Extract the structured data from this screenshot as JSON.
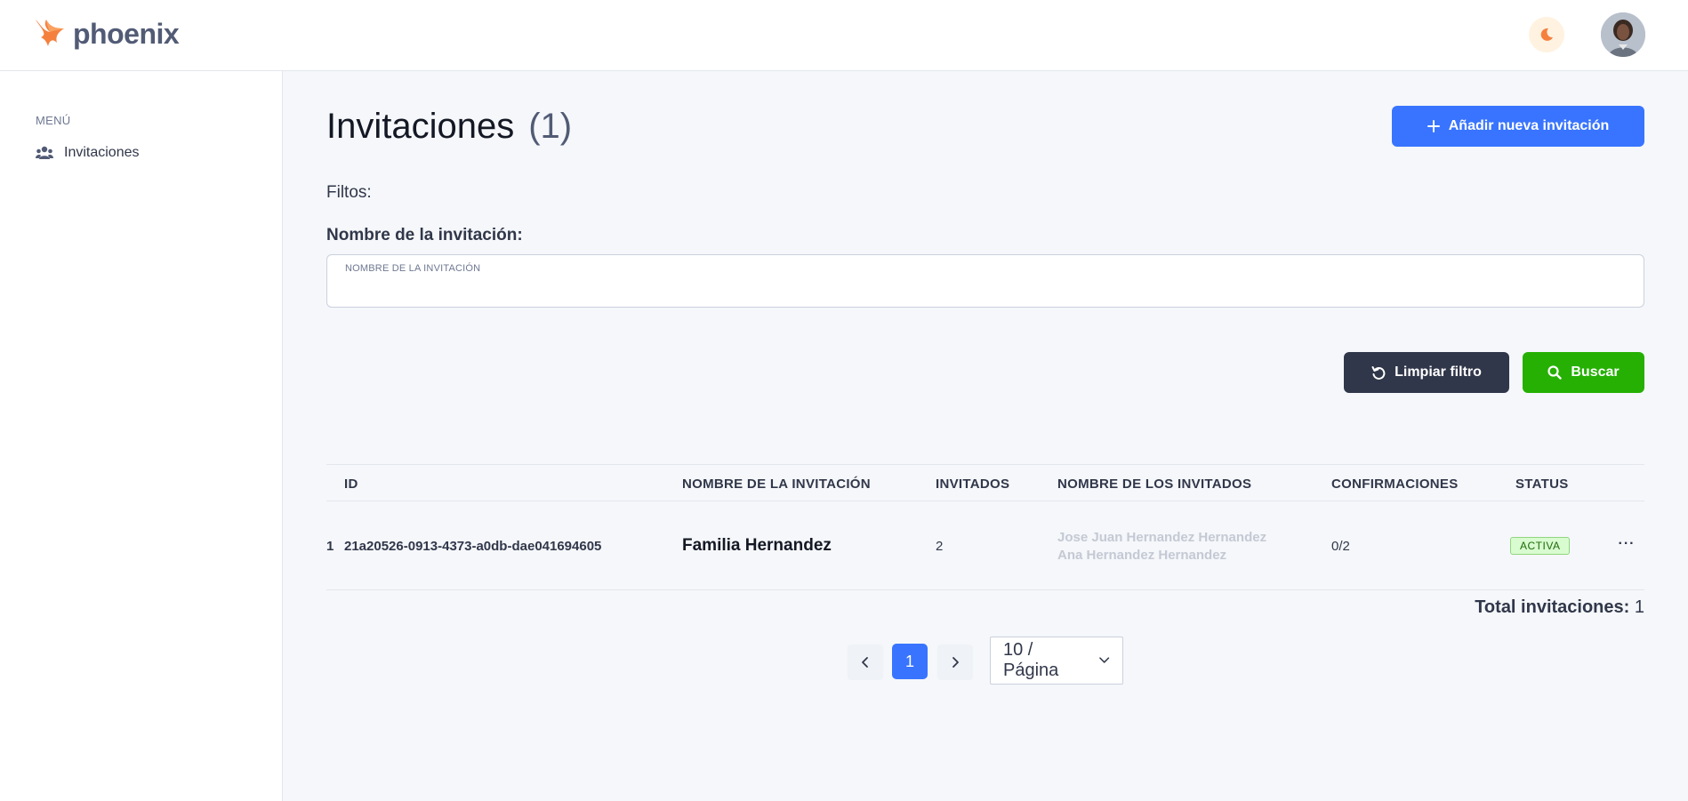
{
  "brand": {
    "name": "phoenix"
  },
  "sidebar": {
    "menu_label": "MENÚ",
    "items": [
      {
        "label": "Invitaciones",
        "icon": "users-icon"
      }
    ]
  },
  "header": {
    "title": "Invitaciones",
    "count": "(1)",
    "add_button": "Añadir nueva invitación"
  },
  "filters": {
    "label": "Filtos:",
    "name_field_label": "Nombre de la invitación:",
    "name_field_placeholder": "NOMBRE DE LA INVITACIÓN",
    "name_field_value": "",
    "clear_button": "Limpiar filtro",
    "search_button": "Buscar"
  },
  "table": {
    "columns": [
      "ID",
      "NOMBRE DE LA INVITACIÓN",
      "INVITADOS",
      "NOMBRE DE LOS INVITADOS",
      "CONFIRMACIONES",
      "STATUS"
    ],
    "rows": [
      {
        "index": "1",
        "id": "21a20526-0913-4373-a0db-dae041694605",
        "name": "Familia Hernandez",
        "guests_count": "2",
        "guest_1": "Jose Juan Hernandez Hernandez",
        "guest_2": "Ana Hernandez Hernandez",
        "confirmations": "0/2",
        "status": "ACTIVA",
        "actions": "···"
      }
    ]
  },
  "summary": {
    "total_label": "Total invitaciones:",
    "total_value": "1"
  },
  "pagination": {
    "current_page": "1",
    "page_size": "10 / Página"
  },
  "colors": {
    "primary": "#3874ff",
    "success": "#25b003",
    "dark": "#31374a",
    "accent_orange": "#f5803e"
  }
}
